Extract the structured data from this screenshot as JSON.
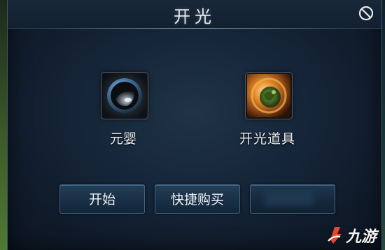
{
  "window": {
    "title": "开光"
  },
  "slots": [
    {
      "label": "元婴",
      "icon": "yuanying-orb-icon"
    },
    {
      "label": "开光道具",
      "icon": "kaiguang-item-icon"
    }
  ],
  "buttons": {
    "start_label": "开始",
    "quick_buy_label": "快捷购买",
    "third_label": ""
  },
  "watermark": {
    "text": "九游",
    "icon": "9game-logo-icon"
  },
  "colors": {
    "panel_bg": "#16263a",
    "button_bg": "#1a3148",
    "button_border": "#3e6482",
    "text": "#e8ecef",
    "watermark_logo": "#e8472b"
  }
}
